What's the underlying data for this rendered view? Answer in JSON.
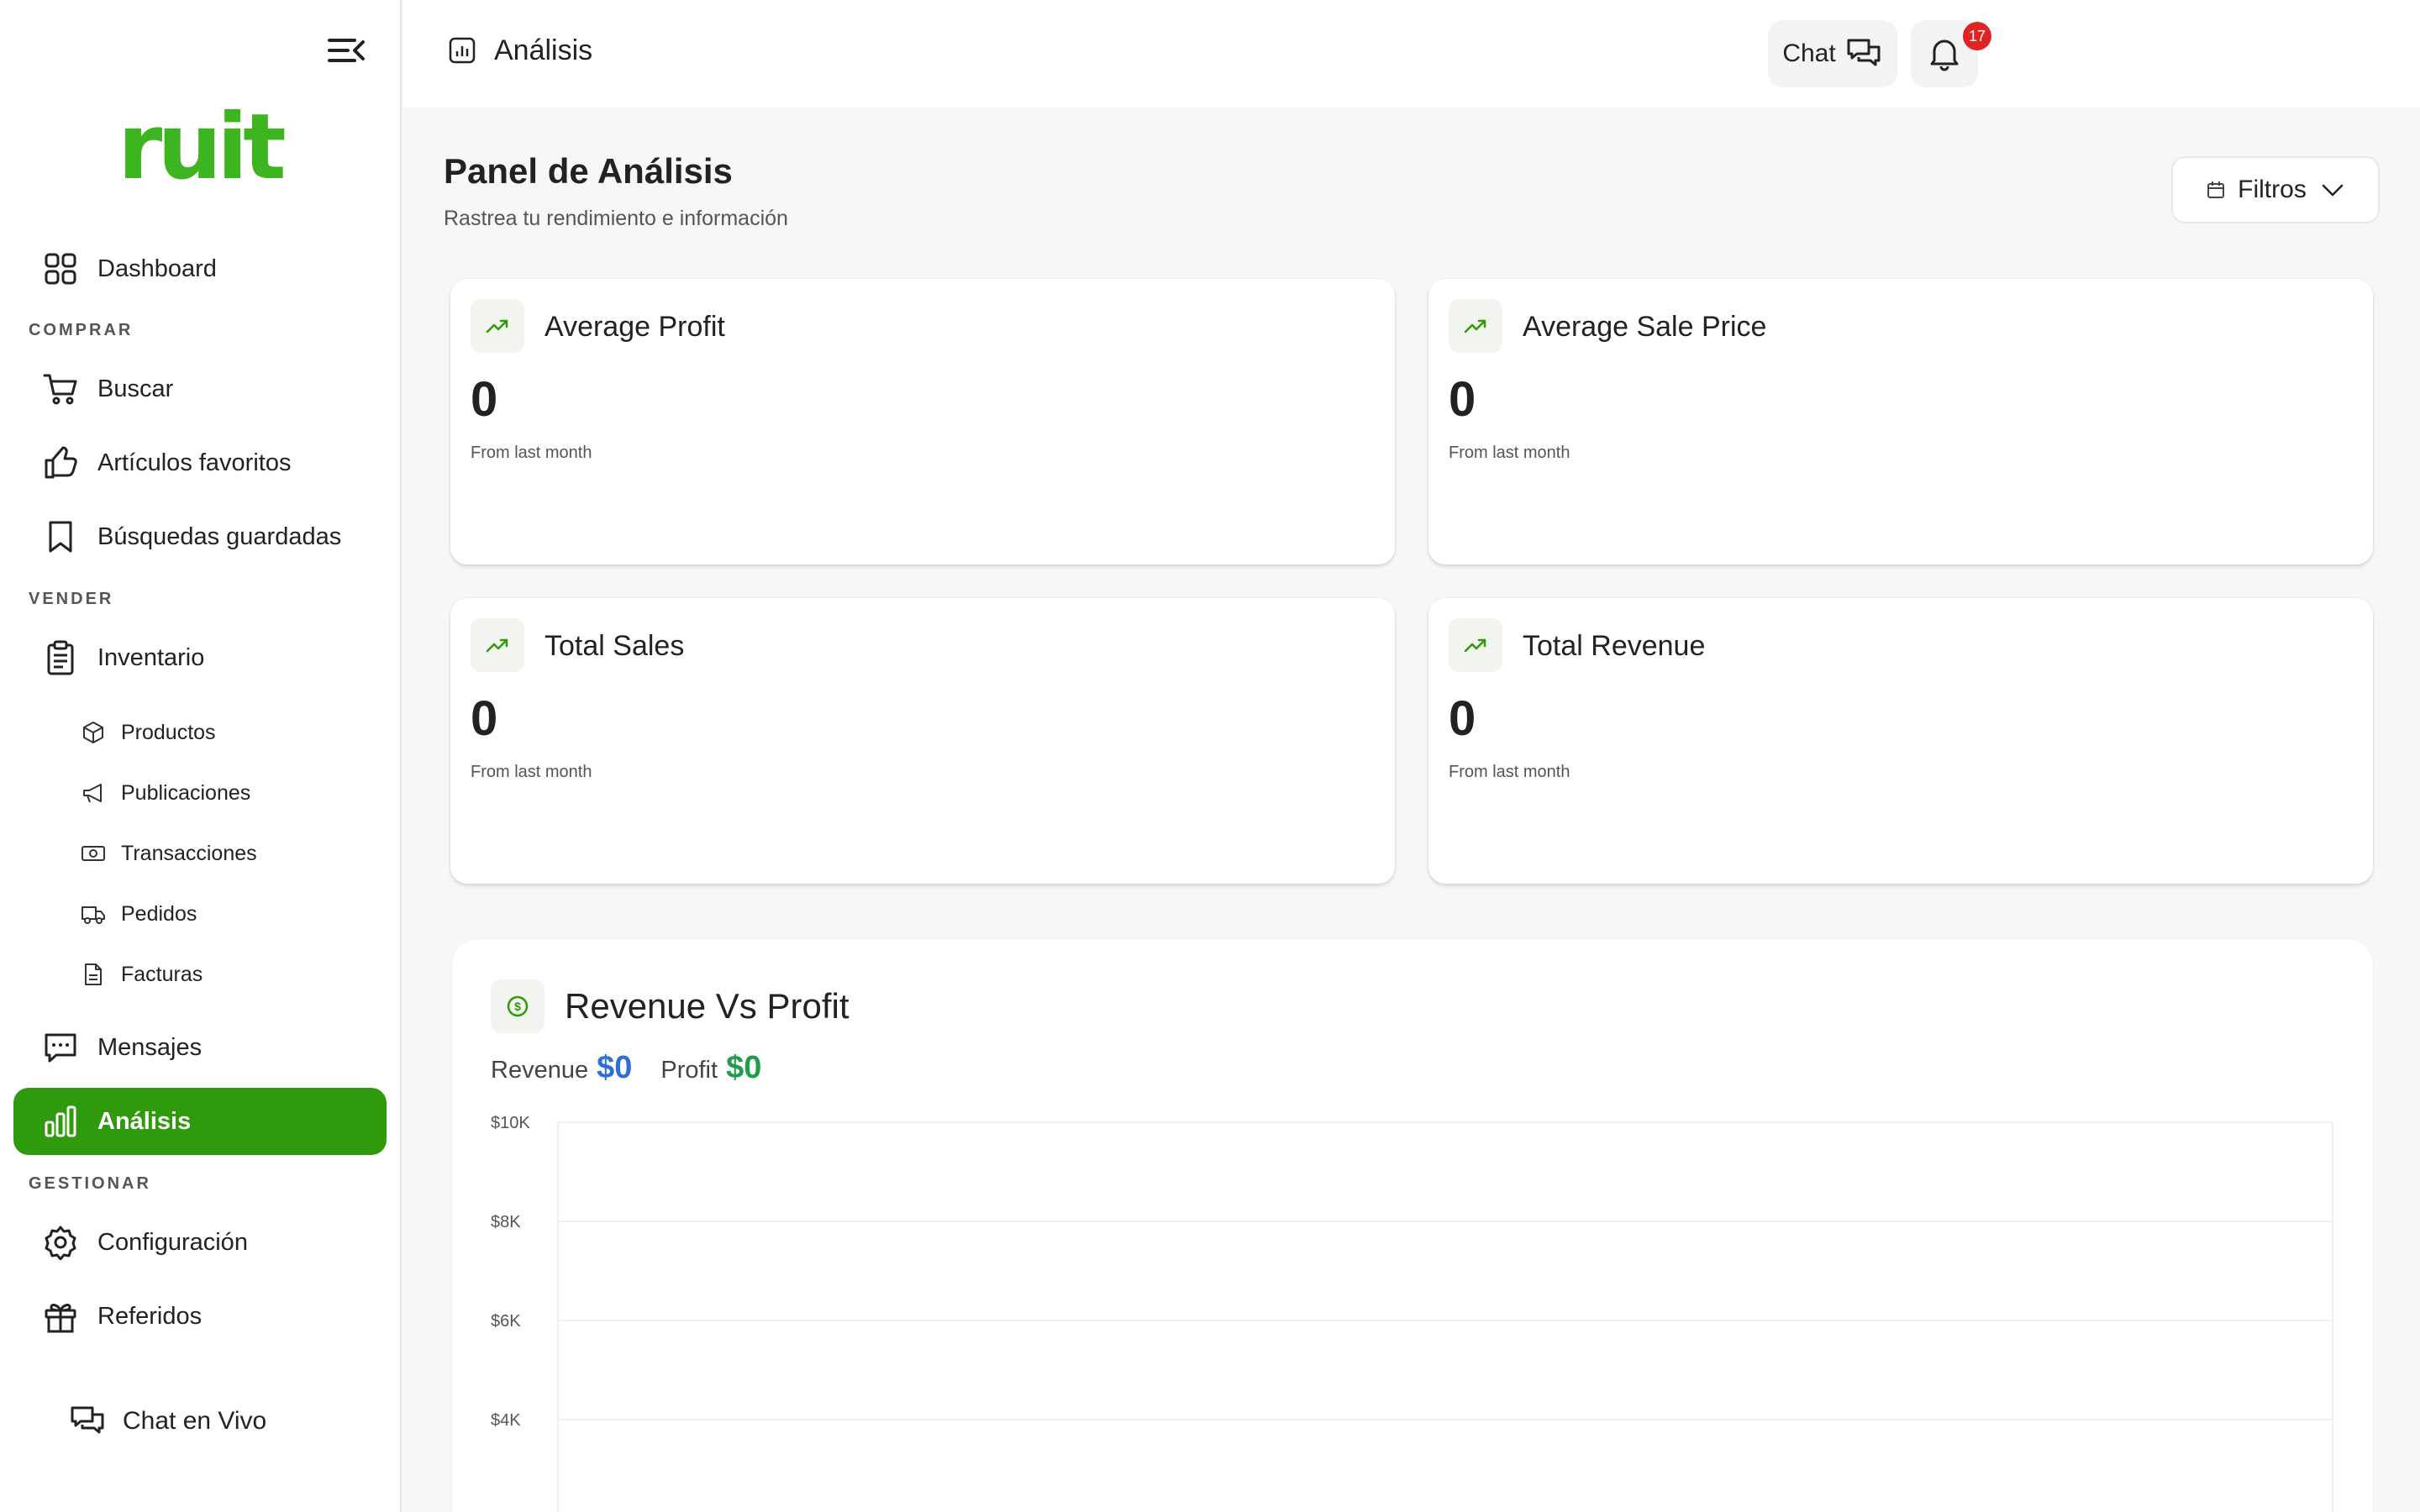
{
  "brand": {
    "logo_text": "ruit",
    "color": "#3cb521"
  },
  "sidebar": {
    "dashboard": "Dashboard",
    "sections": {
      "buy": "COMPRAR",
      "sell": "VENDER",
      "manage": "GESTIONAR"
    },
    "buy_items": [
      {
        "label": "Buscar",
        "icon": "cart-icon"
      },
      {
        "label": "Artículos favoritos",
        "icon": "thumbs-up-icon"
      },
      {
        "label": "Búsquedas guardadas",
        "icon": "bookmark-icon"
      }
    ],
    "inventory": "Inventario",
    "inventory_sub": [
      {
        "label": "Productos",
        "icon": "box-icon"
      },
      {
        "label": "Publicaciones",
        "icon": "megaphone-icon"
      },
      {
        "label": "Transacciones",
        "icon": "banknote-icon"
      },
      {
        "label": "Pedidos",
        "icon": "truck-icon"
      },
      {
        "label": "Facturas",
        "icon": "file-icon"
      }
    ],
    "messages": "Mensajes",
    "analytics": "Análisis",
    "settings": "Configuración",
    "referrals": "Referidos",
    "live_chat": "Chat en Vivo",
    "active_color": "#2f9a0b"
  },
  "topbar": {
    "title": "Análisis",
    "chat_label": "Chat",
    "notification_count": "17"
  },
  "page": {
    "title": "Panel de Análisis",
    "subtitle": "Rastrea tu rendimiento e información",
    "filters_label": "Filtros"
  },
  "stats": [
    {
      "title": "Average Profit",
      "value": "0",
      "note": "From last month"
    },
    {
      "title": "Average Sale Price",
      "value": "0",
      "note": "From last month"
    },
    {
      "title": "Total Sales",
      "value": "0",
      "note": "From last month"
    },
    {
      "title": "Total Revenue",
      "value": "0",
      "note": "From last month"
    }
  ],
  "chart": {
    "title": "Revenue Vs Profit",
    "revenue_label": "Revenue",
    "revenue_value": "$0",
    "profit_label": "Profit",
    "profit_value": "$0",
    "revenue_color": "#2f6fd6",
    "profit_color": "#1e9e4a"
  },
  "chart_data": {
    "type": "area",
    "title": "Revenue Vs Profit",
    "series": [
      {
        "name": "Revenue",
        "values": []
      },
      {
        "name": "Profit",
        "values": []
      }
    ],
    "y_ticks": [
      "$10K",
      "$8K",
      "$6K",
      "$4K"
    ],
    "ylim": [
      0,
      10000
    ],
    "grid": true
  }
}
